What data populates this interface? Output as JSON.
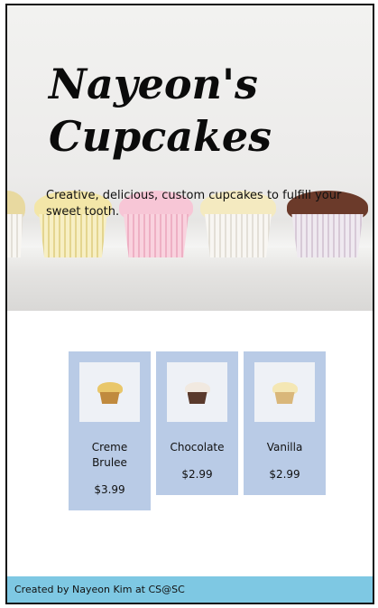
{
  "hero": {
    "title_line1": "Nayeon's",
    "title_line2": "Cupcakes",
    "tagline": "Creative, delicious, custom cupcakes to fulfill your sweet tooth."
  },
  "products": [
    {
      "name": "Creme Brulee",
      "price": "$3.99",
      "image": "creme-brulee-cupcake"
    },
    {
      "name": "Chocolate",
      "price": "$2.99",
      "image": "chocolate-cupcake"
    },
    {
      "name": "Vanilla",
      "price": "$2.99",
      "image": "vanilla-cupcake"
    }
  ],
  "footer": {
    "text": "Created by Nayeon Kim at CS@SC"
  },
  "colors": {
    "card_background": "#b9cbe6",
    "footer_background": "#7ec8e3",
    "text": "#111111"
  }
}
